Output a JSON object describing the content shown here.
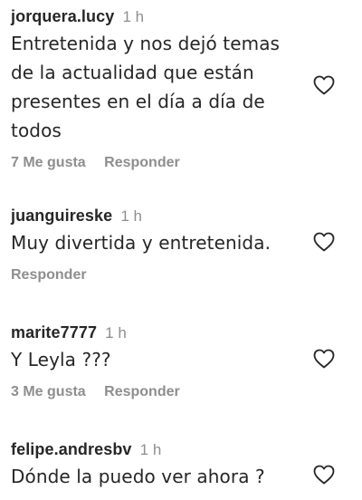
{
  "comments": [
    {
      "username": "jorquera.lucy",
      "time": "1 h",
      "text": "Entretenida y nos dejó temas de la actualidad que están presentes en el día a día de todos",
      "likes": "7 Me gusta",
      "reply": "Responder"
    },
    {
      "username": "juanguireske",
      "time": "1 h",
      "text": "Muy divertida y entretenida.",
      "likes": "",
      "reply": "Responder"
    },
    {
      "username": "marite7777",
      "time": "1 h",
      "text": "Y Leyla ???",
      "likes": "3 Me gusta",
      "reply": "Responder"
    },
    {
      "username": "felipe.andresbv",
      "time": "1 h",
      "text": "Dónde la puedo ver ahora ?",
      "likes": "",
      "reply": ""
    }
  ],
  "icons": {
    "like": "heart-outline-icon"
  },
  "colors": {
    "text": "#262626",
    "secondary": "#8e8e8e",
    "background": "#ffffff"
  }
}
